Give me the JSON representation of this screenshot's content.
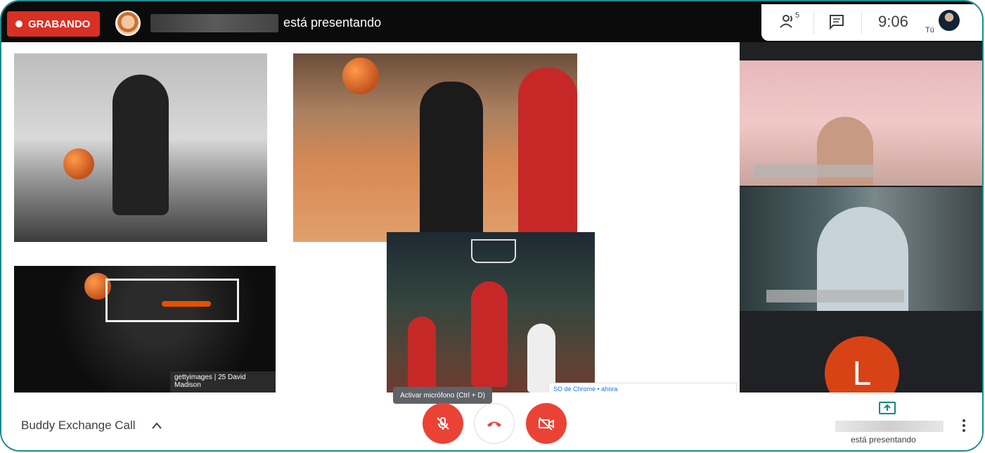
{
  "topbar": {
    "recording_label": "GRABANDO",
    "presenter_text": "está presentando",
    "participants_count": "5",
    "time": "9:06",
    "you_label": "Tú"
  },
  "stage": {
    "getty_label": "gettyimages | 25 David Madison",
    "notification_text": "SO de Chrome • ahora"
  },
  "side": {
    "avatar_letter": "L"
  },
  "bottombar": {
    "meeting_title": "Buddy Exchange Call",
    "mic_tooltip": "Activar micrófono (Ctrl + D)",
    "presenting_text": "está presentando"
  },
  "colors": {
    "record_red": "#d93025",
    "control_red": "#ea4335",
    "avatar_orange": "#d84315",
    "frame_teal": "#1d8a8c"
  },
  "icons": [
    "record-dot-icon",
    "people-icon",
    "chat-icon",
    "chevron-up-icon",
    "mic-off-icon",
    "hang-up-icon",
    "camera-off-icon",
    "present-screen-icon",
    "more-vert-icon"
  ]
}
